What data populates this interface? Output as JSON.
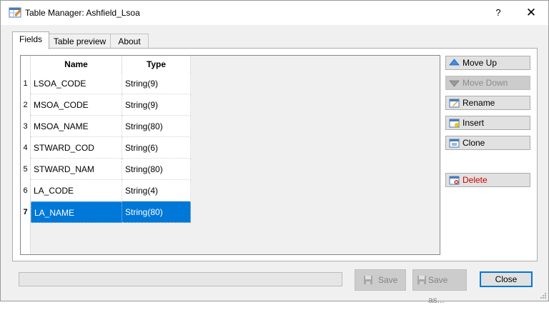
{
  "window": {
    "title": "Table Manager: Ashfield_Lsoa",
    "help_label": "?",
    "close_glyph": "✕"
  },
  "tabs": [
    {
      "label": "Fields",
      "active": true
    },
    {
      "label": "Table preview",
      "active": false
    },
    {
      "label": "About",
      "active": false
    }
  ],
  "grid": {
    "columns": [
      "Name",
      "Type"
    ],
    "rows": [
      {
        "num": "1",
        "name": "LSOA_CODE",
        "type": "String(9)"
      },
      {
        "num": "2",
        "name": "MSOA_CODE",
        "type": "String(9)"
      },
      {
        "num": "3",
        "name": "MSOA_NAME",
        "type": "String(80)"
      },
      {
        "num": "4",
        "name": "STWARD_COD",
        "type": "String(6)"
      },
      {
        "num": "5",
        "name": "STWARD_NAM",
        "type": "String(80)"
      },
      {
        "num": "6",
        "name": "LA_CODE",
        "type": "String(4)"
      },
      {
        "num": "7",
        "name": "LA_NAME",
        "type": "String(80)"
      }
    ],
    "selected_row": "7"
  },
  "side_buttons": {
    "move_up": "Move Up",
    "move_down": "Move Down",
    "rename": "Rename",
    "insert": "Insert",
    "clone": "Clone",
    "delete": "Delete"
  },
  "footer": {
    "save": "Save",
    "save_as": "Save as...",
    "close": "Close"
  },
  "colors": {
    "selection": "#0078d7",
    "delete_text": "#d40000"
  }
}
